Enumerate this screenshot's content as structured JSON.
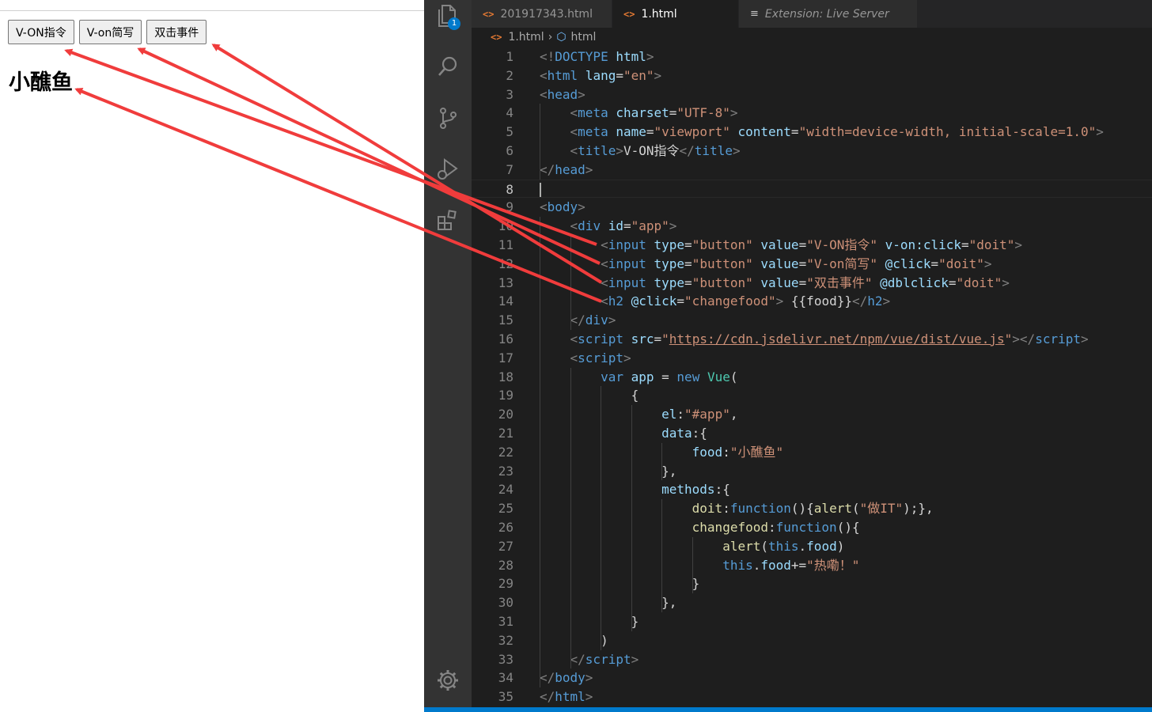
{
  "browser": {
    "buttons": [
      {
        "label": "V-ON指令"
      },
      {
        "label": "V-on简写"
      },
      {
        "label": "双击事件"
      }
    ],
    "heading": "小醮鱼"
  },
  "vscode": {
    "activity_bar": {
      "icons": [
        "explorer-icon",
        "search-icon",
        "source-control-icon",
        "run-debug-icon",
        "extensions-icon",
        "settings-gear-icon"
      ],
      "explorer_badge": "1"
    },
    "tabs": [
      {
        "label": "201917343.html",
        "active": false
      },
      {
        "label": "1.html",
        "active": true,
        "modified": true
      },
      {
        "label": "Extension: Live Server",
        "active": false
      }
    ],
    "breadcrumb": {
      "file": "1.html",
      "symbol": "html"
    },
    "cursor_line": 8,
    "code_lines": [
      [
        [
          "br",
          "<!"
        ],
        [
          "tag",
          "DOCTYPE"
        ],
        [
          "txt",
          " "
        ],
        [
          "at",
          "html"
        ],
        [
          "br",
          ">"
        ]
      ],
      [
        [
          "br",
          "<"
        ],
        [
          "tag",
          "html"
        ],
        [
          "txt",
          " "
        ],
        [
          "at",
          "lang"
        ],
        [
          "txt",
          "="
        ],
        [
          "str",
          "\"en\""
        ],
        [
          "br",
          ">"
        ]
      ],
      [
        [
          "br",
          "<"
        ],
        [
          "tag",
          "head"
        ],
        [
          "br",
          ">"
        ]
      ],
      [
        [
          "txt",
          "    "
        ],
        [
          "br",
          "<"
        ],
        [
          "tag",
          "meta"
        ],
        [
          "txt",
          " "
        ],
        [
          "at",
          "charset"
        ],
        [
          "txt",
          "="
        ],
        [
          "str",
          "\"UTF-8\""
        ],
        [
          "br",
          ">"
        ]
      ],
      [
        [
          "txt",
          "    "
        ],
        [
          "br",
          "<"
        ],
        [
          "tag",
          "meta"
        ],
        [
          "txt",
          " "
        ],
        [
          "at",
          "name"
        ],
        [
          "txt",
          "="
        ],
        [
          "str",
          "\"viewport\""
        ],
        [
          "txt",
          " "
        ],
        [
          "at",
          "content"
        ],
        [
          "txt",
          "="
        ],
        [
          "str",
          "\"width=device-width, initial-scale=1.0\""
        ],
        [
          "br",
          ">"
        ]
      ],
      [
        [
          "txt",
          "    "
        ],
        [
          "br",
          "<"
        ],
        [
          "tag",
          "title"
        ],
        [
          "br",
          ">"
        ],
        [
          "txt",
          "V-ON指令"
        ],
        [
          "br",
          "</"
        ],
        [
          "tag",
          "title"
        ],
        [
          "br",
          ">"
        ]
      ],
      [
        [
          "br",
          "</"
        ],
        [
          "tag",
          "head"
        ],
        [
          "br",
          ">"
        ]
      ],
      [],
      [
        [
          "br",
          "<"
        ],
        [
          "tag",
          "body"
        ],
        [
          "br",
          ">"
        ]
      ],
      [
        [
          "txt",
          "    "
        ],
        [
          "br",
          "<"
        ],
        [
          "tag",
          "div"
        ],
        [
          "txt",
          " "
        ],
        [
          "at",
          "id"
        ],
        [
          "txt",
          "="
        ],
        [
          "str",
          "\"app\""
        ],
        [
          "br",
          ">"
        ]
      ],
      [
        [
          "txt",
          "        "
        ],
        [
          "br",
          "<"
        ],
        [
          "tag",
          "input"
        ],
        [
          "txt",
          " "
        ],
        [
          "at",
          "type"
        ],
        [
          "txt",
          "="
        ],
        [
          "str",
          "\"button\""
        ],
        [
          "txt",
          " "
        ],
        [
          "at",
          "value"
        ],
        [
          "txt",
          "="
        ],
        [
          "str",
          "\"V-ON指令\""
        ],
        [
          "txt",
          " "
        ],
        [
          "at",
          "v-on:click"
        ],
        [
          "txt",
          "="
        ],
        [
          "str",
          "\"doit\""
        ],
        [
          "br",
          ">"
        ]
      ],
      [
        [
          "txt",
          "        "
        ],
        [
          "br",
          "<"
        ],
        [
          "tag",
          "input"
        ],
        [
          "txt",
          " "
        ],
        [
          "at",
          "type"
        ],
        [
          "txt",
          "="
        ],
        [
          "str",
          "\"button\""
        ],
        [
          "txt",
          " "
        ],
        [
          "at",
          "value"
        ],
        [
          "txt",
          "="
        ],
        [
          "str",
          "\"V-on简写\""
        ],
        [
          "txt",
          " "
        ],
        [
          "at",
          "@click"
        ],
        [
          "txt",
          "="
        ],
        [
          "str",
          "\"doit\""
        ],
        [
          "br",
          ">"
        ]
      ],
      [
        [
          "txt",
          "        "
        ],
        [
          "br",
          "<"
        ],
        [
          "tag",
          "input"
        ],
        [
          "txt",
          " "
        ],
        [
          "at",
          "type"
        ],
        [
          "txt",
          "="
        ],
        [
          "str",
          "\"button\""
        ],
        [
          "txt",
          " "
        ],
        [
          "at",
          "value"
        ],
        [
          "txt",
          "="
        ],
        [
          "str",
          "\"双击事件\""
        ],
        [
          "txt",
          " "
        ],
        [
          "at",
          "@dblclick"
        ],
        [
          "txt",
          "="
        ],
        [
          "str",
          "\"doit\""
        ],
        [
          "br",
          ">"
        ]
      ],
      [
        [
          "txt",
          "        "
        ],
        [
          "br",
          "<"
        ],
        [
          "tag",
          "h2"
        ],
        [
          "txt",
          " "
        ],
        [
          "at",
          "@click"
        ],
        [
          "txt",
          "="
        ],
        [
          "str",
          "\"changefood\""
        ],
        [
          "br",
          ">"
        ],
        [
          "txt",
          " {{food}}"
        ],
        [
          "br",
          "</"
        ],
        [
          "tag",
          "h2"
        ],
        [
          "br",
          ">"
        ]
      ],
      [
        [
          "txt",
          "    "
        ],
        [
          "br",
          "</"
        ],
        [
          "tag",
          "div"
        ],
        [
          "br",
          ">"
        ]
      ],
      [
        [
          "txt",
          "    "
        ],
        [
          "br",
          "<"
        ],
        [
          "tag",
          "script"
        ],
        [
          "txt",
          " "
        ],
        [
          "at",
          "src"
        ],
        [
          "txt",
          "="
        ],
        [
          "str",
          "\""
        ],
        [
          "stru",
          "https://cdn.jsdelivr.net/npm/vue/dist/vue.js"
        ],
        [
          "str",
          "\""
        ],
        [
          "br",
          "></"
        ],
        [
          "tag",
          "script"
        ],
        [
          "br",
          ">"
        ]
      ],
      [
        [
          "txt",
          "    "
        ],
        [
          "br",
          "<"
        ],
        [
          "tag",
          "script"
        ],
        [
          "br",
          ">"
        ]
      ],
      [
        [
          "txt",
          "        "
        ],
        [
          "kw",
          "var"
        ],
        [
          "txt",
          " "
        ],
        [
          "var",
          "app"
        ],
        [
          "txt",
          " = "
        ],
        [
          "kw",
          "new"
        ],
        [
          "txt",
          " "
        ],
        [
          "cls",
          "Vue"
        ],
        [
          "txt",
          "("
        ]
      ],
      [
        [
          "txt",
          "            {"
        ]
      ],
      [
        [
          "txt",
          "                "
        ],
        [
          "var",
          "el"
        ],
        [
          "txt",
          ":"
        ],
        [
          "str",
          "\"#app\""
        ],
        [
          "txt",
          ","
        ]
      ],
      [
        [
          "txt",
          "                "
        ],
        [
          "var",
          "data"
        ],
        [
          "txt",
          ":{"
        ]
      ],
      [
        [
          "txt",
          "                    "
        ],
        [
          "var",
          "food"
        ],
        [
          "txt",
          ":"
        ],
        [
          "str",
          "\"小醮鱼\""
        ]
      ],
      [
        [
          "txt",
          "                },"
        ]
      ],
      [
        [
          "txt",
          "                "
        ],
        [
          "var",
          "methods"
        ],
        [
          "txt",
          ":{"
        ]
      ],
      [
        [
          "txt",
          "                    "
        ],
        [
          "fn",
          "doit"
        ],
        [
          "txt",
          ":"
        ],
        [
          "kw",
          "function"
        ],
        [
          "txt",
          "(){"
        ],
        [
          "fn",
          "alert"
        ],
        [
          "txt",
          "("
        ],
        [
          "str",
          "\"做IT\""
        ],
        [
          "txt",
          ");},"
        ]
      ],
      [
        [
          "txt",
          "                    "
        ],
        [
          "fn",
          "changefood"
        ],
        [
          "txt",
          ":"
        ],
        [
          "kw",
          "function"
        ],
        [
          "txt",
          "(){"
        ]
      ],
      [
        [
          "txt",
          "                        "
        ],
        [
          "fn",
          "alert"
        ],
        [
          "txt",
          "("
        ],
        [
          "kw",
          "this"
        ],
        [
          "txt",
          "."
        ],
        [
          "var",
          "food"
        ],
        [
          "txt",
          ")"
        ]
      ],
      [
        [
          "txt",
          "                        "
        ],
        [
          "kw",
          "this"
        ],
        [
          "txt",
          "."
        ],
        [
          "var",
          "food"
        ],
        [
          "txt",
          "+="
        ],
        [
          "str",
          "\"热嘞！\""
        ]
      ],
      [
        [
          "txt",
          "                    }"
        ]
      ],
      [
        [
          "txt",
          "                },"
        ]
      ],
      [
        [
          "txt",
          "            }"
        ]
      ],
      [
        [
          "txt",
          "        )"
        ]
      ],
      [
        [
          "txt",
          "    "
        ],
        [
          "br",
          "</"
        ],
        [
          "tag",
          "script"
        ],
        [
          "br",
          ">"
        ]
      ],
      [
        [
          "br",
          "</"
        ],
        [
          "tag",
          "body"
        ],
        [
          "br",
          ">"
        ]
      ],
      [
        [
          "br",
          "</"
        ],
        [
          "tag",
          "html"
        ],
        [
          "br",
          ">"
        ]
      ]
    ]
  },
  "colors": {
    "editor_bg": "#1e1e1e",
    "activity_bg": "#333333",
    "accent": "#007acc",
    "arrow": "#f03c3c"
  }
}
